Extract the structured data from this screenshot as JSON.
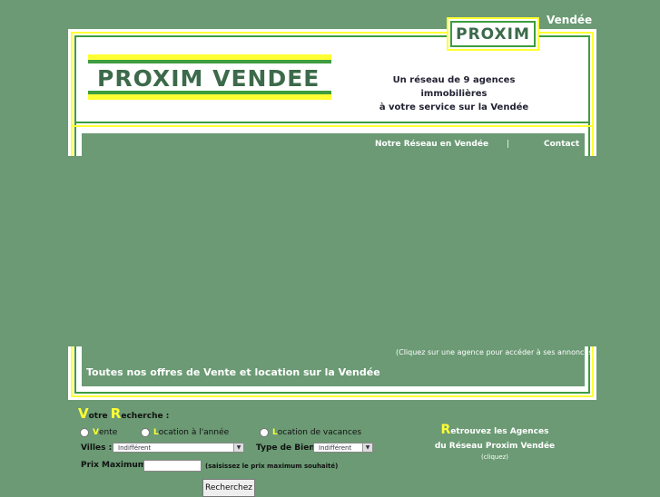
{
  "header": {
    "region": "Vendée",
    "small_logo": "PROXIM",
    "main_logo": "PROXIM VENDEE",
    "tagline_line1": "Un réseau de 9 agences immobilières",
    "tagline_line2": "à votre service sur la Vendée"
  },
  "nav": {
    "network": "Notre Réseau en Vendée",
    "separator": "|",
    "contact": "Contact"
  },
  "content": {
    "agency_hint": "(Cliquez sur une agence pour accéder à ses annonces)",
    "offers_title": "Toutes nos offres de Vente et location sur la Vendée"
  },
  "search": {
    "title_v": "V",
    "title_rest1": "otre ",
    "title_r": "R",
    "title_rest2": "echerche :",
    "options": [
      {
        "initial": "V",
        "rest": "ente"
      },
      {
        "initial": "L",
        "rest": "ocation à l'année"
      },
      {
        "initial": "L",
        "rest": "ocation de vacances"
      }
    ],
    "city_label": "Villes :",
    "city_value": "Indifférent",
    "type_label": "Type de Bien :",
    "type_value": "Indifférent",
    "price_label": "Prix Maximum :",
    "price_hint": "(saisissez le prix maximum souhaité)",
    "button": "Recherchez"
  },
  "agencies": {
    "initial": "R",
    "line1_rest": "etrouvez les Agences",
    "line2": "du Réseau Proxim Vendée",
    "line3": "(cliquez)"
  },
  "colors": {
    "background": "#6b9a74",
    "accent_yellow": "#ffff33",
    "accent_green": "#3e9d3e",
    "logo_text": "#3c6a4a"
  }
}
